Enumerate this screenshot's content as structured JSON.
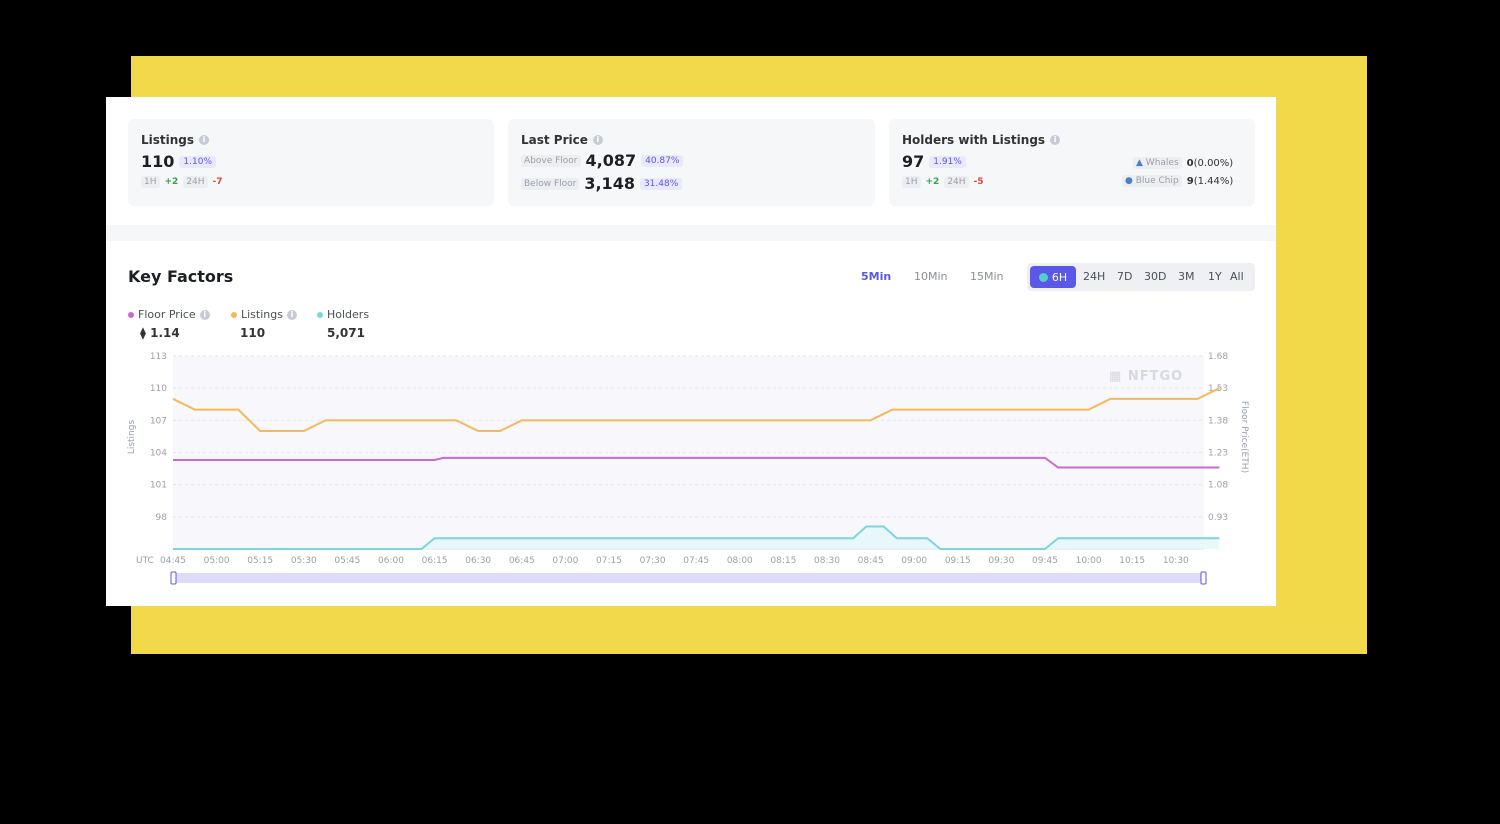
{
  "colors": {
    "accent": "#5b57e8",
    "floor": "#c66ad8",
    "listings": "#f3b95a",
    "holders": "#7bd6dd",
    "frame": "#f2d94a"
  },
  "cards": {
    "listings": {
      "title": "Listings",
      "value": "110",
      "pct": "1.10%",
      "h1_label": "1H",
      "h1_val": "+2",
      "h24_label": "24H",
      "h24_val": "-7"
    },
    "last_price": {
      "title": "Last Price",
      "above_label": "Above Floor",
      "above_val": "4,087",
      "above_pct": "40.87%",
      "below_label": "Below Floor",
      "below_val": "3,148",
      "below_pct": "31.48%"
    },
    "holders": {
      "title": "Holders with Listings",
      "value": "97",
      "pct": "1.91%",
      "h1_label": "1H",
      "h1_val": "+2",
      "h24_label": "24H",
      "h24_val": "-5",
      "whales_label": "Whales",
      "whales_val": "0",
      "whales_pct": "(0.00%)",
      "blue_label": "Blue Chip",
      "blue_val": "9",
      "blue_pct": "(1.44%)"
    }
  },
  "key_factors": {
    "title": "Key Factors",
    "intervals": [
      "5Min",
      "10Min",
      "15Min"
    ],
    "ranges": [
      "6H",
      "24H",
      "7D",
      "30D",
      "3M",
      "1Y",
      "All"
    ],
    "legend": [
      {
        "name": "Floor Price",
        "value": "⧫ 1.14"
      },
      {
        "name": "Listings",
        "value": "110"
      },
      {
        "name": "Holders",
        "value": "5,071"
      }
    ]
  },
  "watermark": "NFTGO",
  "chart_data": {
    "type": "line",
    "x_prefix": "UTC",
    "x": [
      "04:45",
      "05:00",
      "05:15",
      "05:30",
      "05:45",
      "06:00",
      "06:15",
      "06:30",
      "06:45",
      "07:00",
      "07:15",
      "07:30",
      "07:45",
      "08:00",
      "08:15",
      "08:30",
      "08:45",
      "09:00",
      "09:15",
      "09:30",
      "09:45",
      "10:00",
      "10:15",
      "10:30"
    ],
    "ylabel_left": "Listings",
    "ylabel_right": "Floor Price(ETH)",
    "yticks_left": [
      "113",
      "110",
      "107",
      "104",
      "101",
      "98"
    ],
    "yticks_right": [
      "1.68",
      "1.53",
      "1.38",
      "1.23",
      "1.08",
      "0.93"
    ],
    "ylim_left": [
      95,
      113
    ],
    "ylim_right": [
      0.78,
      1.68
    ],
    "series": [
      {
        "name": "Listings",
        "axis": "left",
        "values": [
          [
            0,
            109
          ],
          [
            0.5,
            108
          ],
          [
            1.5,
            108
          ],
          [
            2,
            106
          ],
          [
            3,
            106
          ],
          [
            3.5,
            107
          ],
          [
            6.5,
            107
          ],
          [
            7,
            106
          ],
          [
            7.5,
            106
          ],
          [
            8,
            107
          ],
          [
            16,
            107
          ],
          [
            16.5,
            108
          ],
          [
            21,
            108
          ],
          [
            21.5,
            109
          ],
          [
            23.5,
            109
          ],
          [
            24,
            110
          ]
        ]
      },
      {
        "name": "Floor Price",
        "axis": "right",
        "values": [
          [
            0,
            1.195
          ],
          [
            6,
            1.195
          ],
          [
            6.2,
            1.205
          ],
          [
            20,
            1.205
          ],
          [
            20.3,
            1.16
          ],
          [
            24,
            1.16
          ]
        ]
      },
      {
        "name": "Holders",
        "axis": "left",
        "values": [
          [
            0,
            95
          ],
          [
            5.7,
            95
          ],
          [
            6,
            96
          ],
          [
            15.6,
            96
          ],
          [
            15.9,
            97.1
          ],
          [
            16.3,
            97.1
          ],
          [
            16.6,
            96
          ],
          [
            17.3,
            96
          ],
          [
            17.6,
            95
          ],
          [
            20,
            95
          ],
          [
            20.3,
            96
          ],
          [
            24,
            96
          ]
        ]
      }
    ]
  }
}
